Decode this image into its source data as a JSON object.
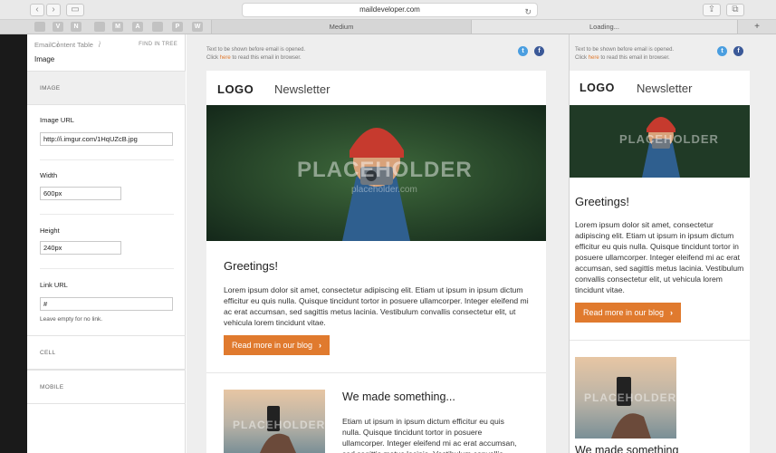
{
  "browser": {
    "url": "maildeveloper.com",
    "bookmarks": [
      "V",
      "N",
      "M",
      "A",
      "P",
      "W"
    ],
    "tabs": [
      "Medium",
      "Loading..."
    ],
    "new_tab": "+"
  },
  "breadcrumb": {
    "items": [
      "Email",
      "/",
      "Content Table",
      "/"
    ],
    "find_in_tree": "FIND IN TREE",
    "current": "Image"
  },
  "panel": {
    "section_image": "IMAGE",
    "image_url_label": "Image URL",
    "image_url_value": "http://i.imgur.com/1HqUZcB.jpg",
    "width_label": "Width",
    "width_value": "600px",
    "height_label": "Height",
    "height_value": "240px",
    "link_url_label": "Link URL",
    "link_url_value": "#",
    "link_hint": "Leave empty for no link.",
    "section_cell": "CELL",
    "section_mobile": "MOBILE"
  },
  "email": {
    "preheader_line1": "Text to be shown before email is opened.",
    "preheader_click": "Click ",
    "preheader_here": "here",
    "preheader_rest": " to read this email in browser.",
    "logo": "LOGO",
    "newsletter": "Newsletter",
    "hero_placeholder": "PLACEHOLDER",
    "hero_placeholder_sub": "placeholder.com",
    "greeting": "Greetings!",
    "body": "Lorem ipsum dolor sit amet, consectetur adipiscing elit. Etiam ut ipsum in ipsum dictum efficitur eu quis nulla. Quisque tincidunt tortor in posuere ullamcorper. Integer eleifend mi ac erat accumsan, sed sagittis metus lacinia. Vestibulum convallis consectetur elit, ut vehicula lorem tincidunt vitae.",
    "cta": "Read more in our blog",
    "cta_arrow": "›",
    "section2_title": "We made something...",
    "section2_body": "Etiam ut ipsum in ipsum dictum efficitur eu quis nulla. Quisque tincidunt tortor in posuere ullamcorper. Integer eleifend mi ac erat accumsan, sed sagittis metus lacinia. Vestibulum convallis"
  },
  "mobile": {
    "section2_title": "We made something"
  },
  "colors": {
    "accent": "#e07a2e",
    "twitter": "#4a9ee0",
    "facebook": "#3b5998"
  },
  "icons": {
    "twitter": "t",
    "facebook": "f",
    "back": "‹",
    "forward": "›",
    "sidebar": "▭",
    "reload": "↻",
    "share": "⇪",
    "tabs": "⧉"
  }
}
